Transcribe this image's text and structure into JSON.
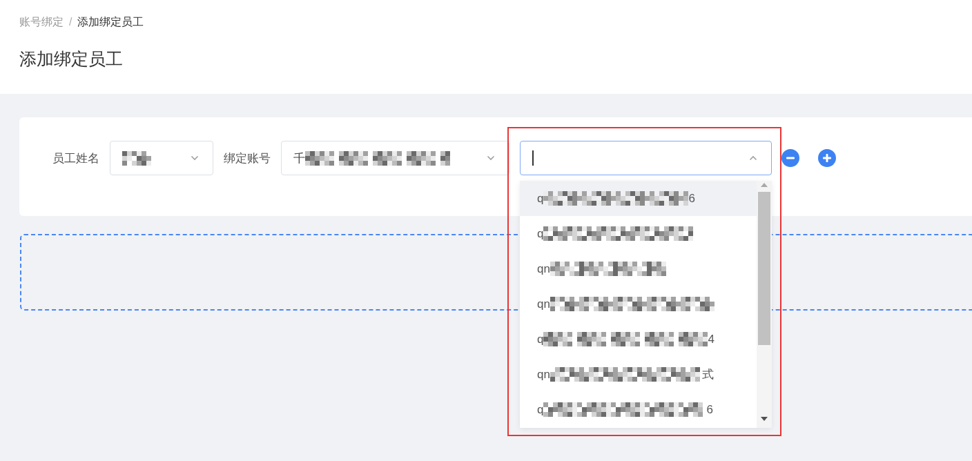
{
  "breadcrumb": {
    "items": [
      {
        "label": "账号绑定",
        "current": false
      },
      {
        "label": "添加绑定员工",
        "current": true
      }
    ],
    "separator": "/"
  },
  "page_title": "添加绑定员工",
  "binding_row": {
    "fields": [
      {
        "label": "员工姓名",
        "select": {
          "blurred": true,
          "open": false
        }
      },
      {
        "label": "绑定账号",
        "select": {
          "value_start": "千",
          "blurred": true,
          "open": false
        }
      },
      {
        "select": {
          "open": true,
          "options": [
            {
              "start": "q",
              "end": "6",
              "blurred": true,
              "highlighted": true
            },
            {
              "start": "q",
              "blurred": true,
              "highlighted": false
            },
            {
              "start": "qn",
              "blurred": true,
              "highlighted": false
            },
            {
              "start": "qn",
              "blurred": true,
              "highlighted": false
            },
            {
              "start": "q",
              "end": "4",
              "blurred": true,
              "highlighted": false
            },
            {
              "start": "qn",
              "end": "式",
              "blurred": true,
              "highlighted": false
            },
            {
              "start": "q",
              "end": "6",
              "blurred": true,
              "highlighted": false
            }
          ]
        }
      }
    ],
    "actions": [
      {
        "kind": "remove"
      },
      {
        "kind": "add"
      }
    ]
  }
}
